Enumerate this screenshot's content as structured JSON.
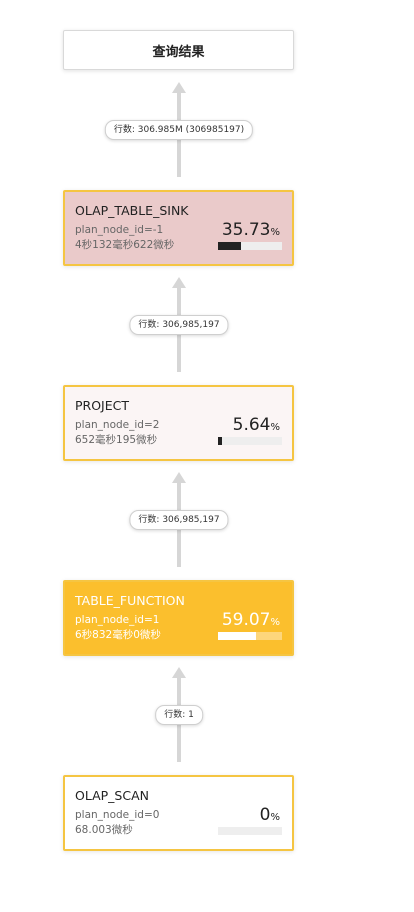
{
  "result": {
    "title": "查询结果"
  },
  "nodes": [
    {
      "name": "OLAP_TABLE_SINK",
      "id_text": "plan_node_id=-1",
      "time": "4秒132毫秒622微秒",
      "percent_value": "35.73",
      "percent_unit": "%",
      "fraction": 0.3573
    },
    {
      "name": "PROJECT",
      "id_text": "plan_node_id=2",
      "time": "652毫秒195微秒",
      "percent_value": "5.64",
      "percent_unit": "%",
      "fraction": 0.0564
    },
    {
      "name": "TABLE_FUNCTION",
      "id_text": "plan_node_id=1",
      "time": "6秒832毫秒0微秒",
      "percent_value": "59.07",
      "percent_unit": "%",
      "fraction": 0.5907
    },
    {
      "name": "OLAP_SCAN",
      "id_text": "plan_node_id=0",
      "time": "68.003微秒",
      "percent_value": "0",
      "percent_unit": "%",
      "fraction": 0
    }
  ],
  "edges": [
    {
      "label": "行数: 306.985M (306985197)"
    },
    {
      "label": "行数: 306,985,197"
    },
    {
      "label": "行数: 306,985,197"
    },
    {
      "label": "行数: 1"
    }
  ],
  "colors": {
    "hot_highlight": "#fbbf2d",
    "warm": "#eacaca",
    "border": "#f5c542",
    "arrow": "#d6d6d6"
  }
}
